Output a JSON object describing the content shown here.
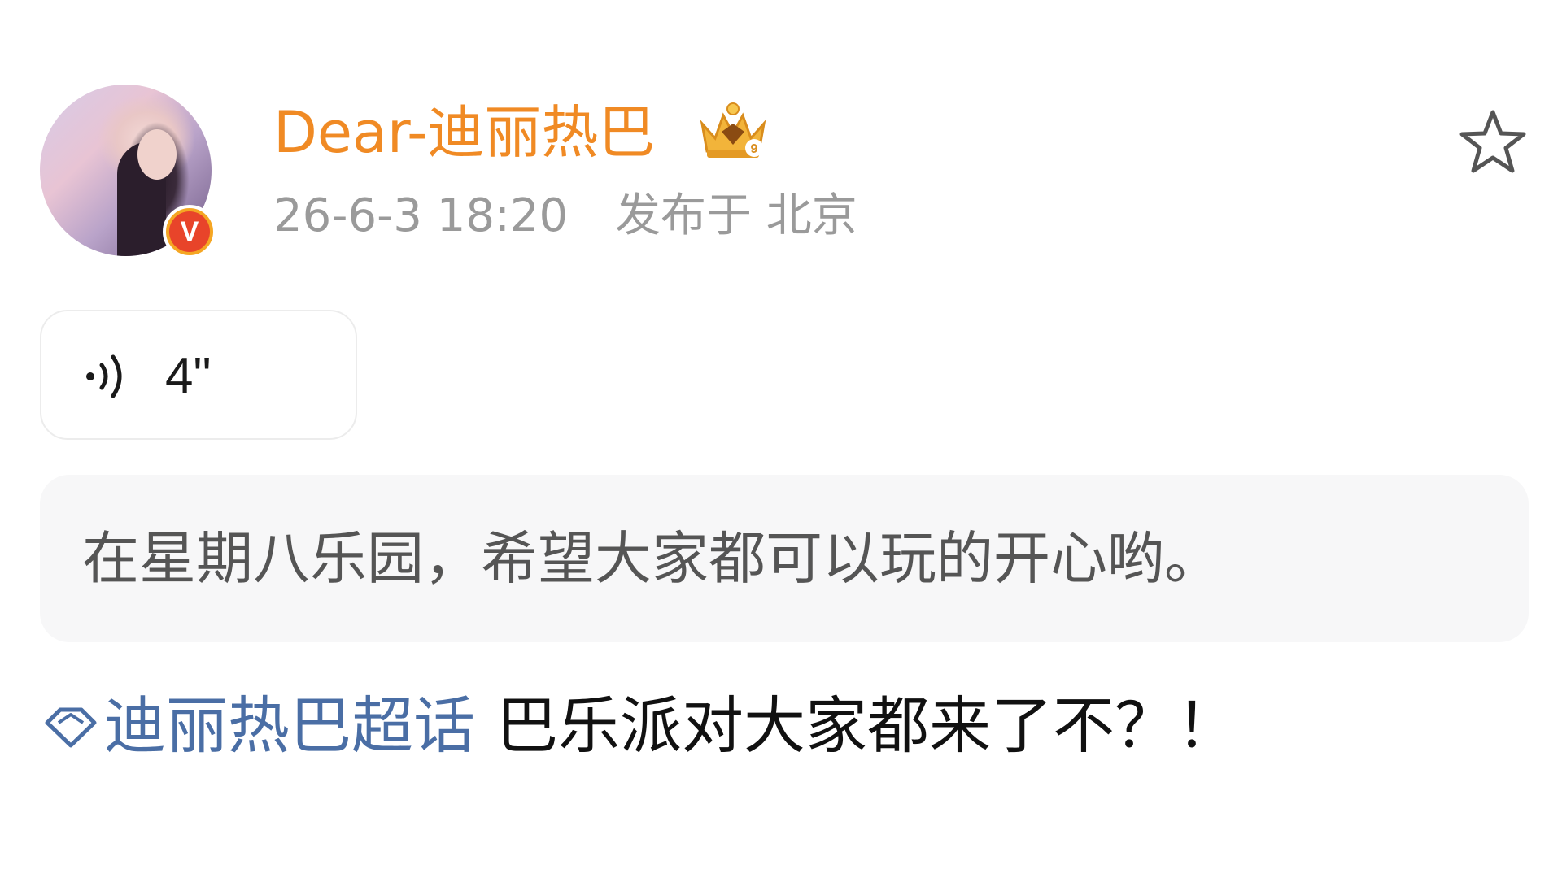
{
  "post": {
    "author": {
      "name": "Dear-迪丽热巴",
      "verified_badge": "V",
      "badge_icon": "crown-level-icon"
    },
    "timestamp": "26-6-3 18:20",
    "location": "发布于 北京",
    "voice": {
      "duration": "4\""
    },
    "quote": "在星期八乐园，希望大家都可以玩的开心哟。",
    "topic": "迪丽热巴超话",
    "text": "巴乐派对大家都来了不？！"
  },
  "colors": {
    "username": "#f08a24",
    "topic_link": "#4a6ea5",
    "meta": "#9a9a9a",
    "quote_bg": "#f7f7f8",
    "verified": "#e8442a"
  }
}
